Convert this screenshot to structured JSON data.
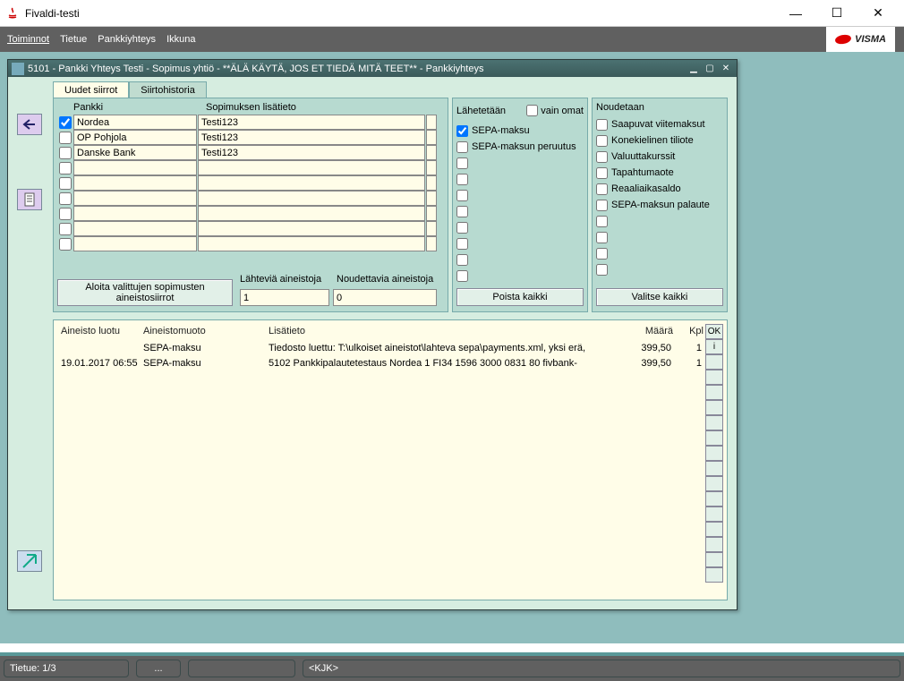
{
  "window": {
    "title": "Fivaldi-testi"
  },
  "menu": {
    "items": [
      "Toiminnot",
      "Tietue",
      "Pankkiyhteys",
      "Ikkuna"
    ]
  },
  "logo": "VISMA",
  "child": {
    "title": "5101 - Pankki Yhteys Testi - Sopimus yhtiö - **ÄLÄ KÄYTÄ, JOS ET TIEDÄ MITÄ TEET** - Pankkiyhteys"
  },
  "tabs": {
    "active": "Uudet siirrot",
    "other": "Siirtohistoria"
  },
  "banks": {
    "hdr_bank": "Pankki",
    "hdr_info": "Sopimuksen lisätieto",
    "rows": [
      {
        "checked": true,
        "bank": "Nordea",
        "info": "Testi123"
      },
      {
        "checked": false,
        "bank": "OP Pohjola",
        "info": "Testi123"
      },
      {
        "checked": false,
        "bank": "Danske Bank",
        "info": "Testi123"
      },
      {
        "checked": false,
        "bank": "",
        "info": ""
      },
      {
        "checked": false,
        "bank": "",
        "info": ""
      },
      {
        "checked": false,
        "bank": "",
        "info": ""
      },
      {
        "checked": false,
        "bank": "",
        "info": ""
      },
      {
        "checked": false,
        "bank": "",
        "info": ""
      },
      {
        "checked": false,
        "bank": "",
        "info": ""
      }
    ],
    "btn_start": "Aloita valittujen sopimusten aineistosiirrot",
    "lbl_outgoing": "Lähteviä aineistoja",
    "lbl_incoming": "Noudettavia aineistoja",
    "val_outgoing": "1",
    "val_incoming": "0"
  },
  "send": {
    "title": "Lähetetään",
    "own_only": "vain omat",
    "items": [
      "SEPA-maksu",
      "SEPA-maksun peruutus"
    ],
    "checked": [
      true,
      false
    ],
    "btn": "Poista kaikki"
  },
  "fetch": {
    "title": "Noudetaan",
    "items": [
      "Saapuvat viitemaksut",
      "Konekielinen tiliote",
      "Valuuttakurssit",
      "Tapahtumaote",
      "Reaaliaikasaldo",
      "SEPA-maksun palaute"
    ],
    "btn": "Valitse kaikki"
  },
  "results": {
    "hdr": {
      "created": "Aineisto luotu",
      "fmt": "Aineistomuoto",
      "detail": "Lisätieto",
      "amt": "Määrä",
      "kpl": "Kpl"
    },
    "rows": [
      {
        "created": "",
        "fmt": "SEPA-maksu",
        "detail": "Tiedosto luettu: T:\\ulkoiset aineistot\\lahteva sepa\\payments.xml, yksi erä,",
        "amt": "399,50",
        "kpl": "1",
        "ok": "OK"
      },
      {
        "created": "19.01.2017 06:55",
        "fmt": "SEPA-maksu",
        "detail": "5102 Pankkipalautetestaus Nordea 1    FI34 1596 3000 0831 80    fivbank-",
        "amt": "399,50",
        "kpl": "1",
        "ok": "i"
      }
    ]
  },
  "status": {
    "record": "Tietue: 1/3",
    "dots": "...",
    "user": "<KJK>"
  }
}
